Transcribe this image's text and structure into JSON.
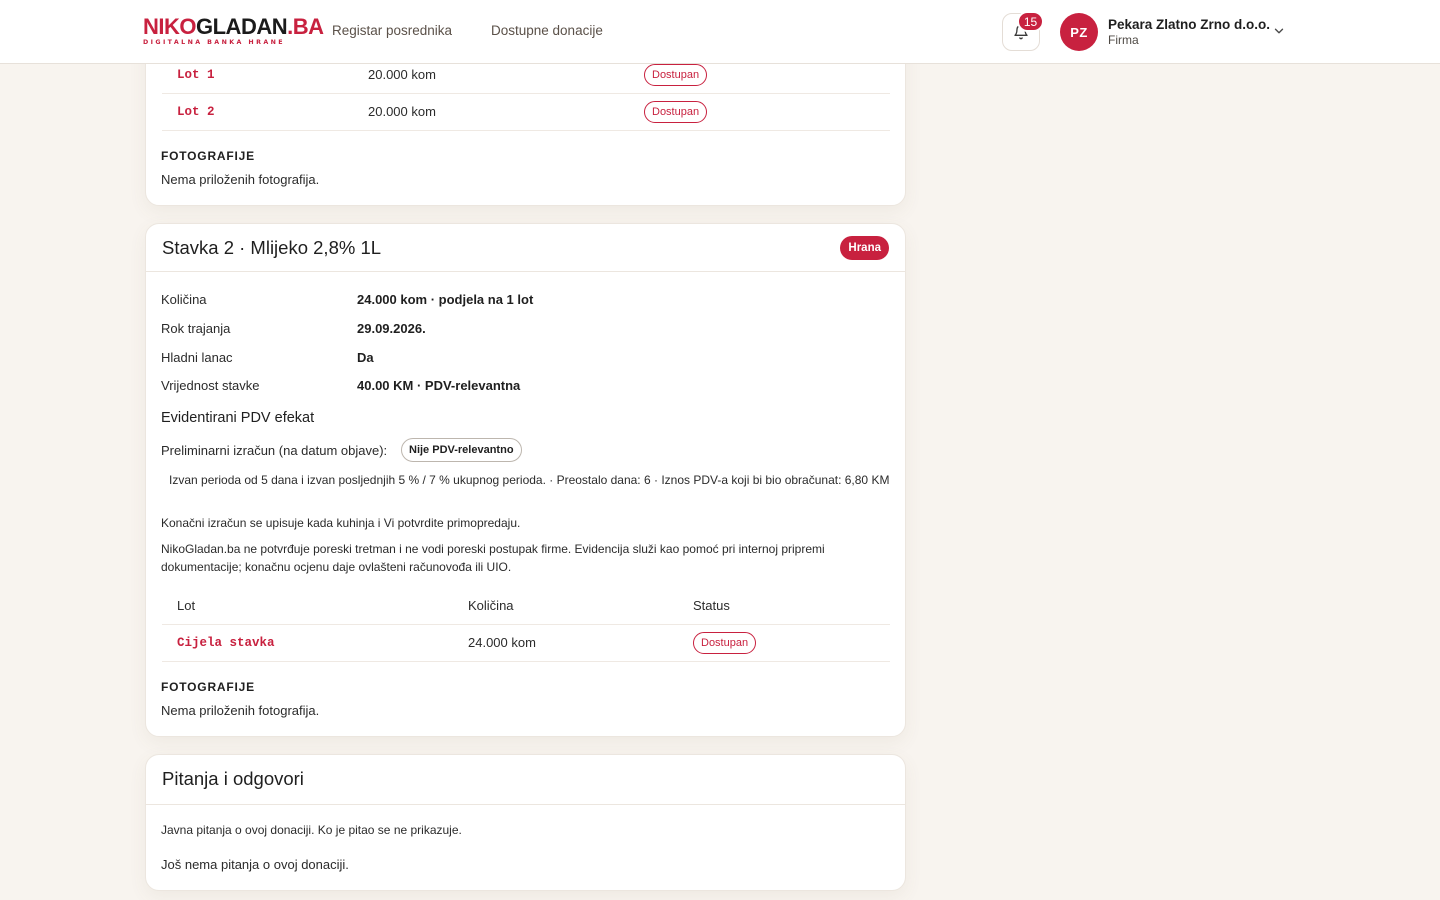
{
  "brand": {
    "logo_part1": "NIKO",
    "logo_part2": "GLADAN",
    "logo_part3": ".BA",
    "tagline": "DIGITALNA BANKA HRANE",
    "accent_color": "#c8213f"
  },
  "nav": {
    "items": [
      {
        "label": "Registar posrednika"
      },
      {
        "label": "Dostupne donacije"
      }
    ]
  },
  "notifications": {
    "count": "15",
    "icon": "bell-icon"
  },
  "user": {
    "initials": "PZ",
    "name": "Pekara Zlatno Zrno d.o.o.",
    "role": "Firma"
  },
  "item1_tail": {
    "lots": [
      {
        "name": "Lot 1",
        "quantity": "20.000 kom",
        "status": "Dostupan"
      },
      {
        "name": "Lot 2",
        "quantity": "20.000 kom",
        "status": "Dostupan"
      }
    ],
    "photos_heading": "FOTOGRAFIJE",
    "photos_text": "Nema priloženih fotografija."
  },
  "item2": {
    "title": "Stavka 2 · Mlijeko 2,8% 1L",
    "category": "Hrana",
    "fields": [
      {
        "label": "Količina",
        "value": "24.000 kom · podjela na 1 lot"
      },
      {
        "label": "Rok trajanja",
        "value": "29.09.2026."
      },
      {
        "label": "Hladni lanac",
        "value": "Da"
      },
      {
        "label": "Vrijednost stavke",
        "value": "40.00 KM · PDV-relevantna"
      }
    ],
    "pdv_heading": "Evidentirani PDV efekat",
    "pdv_preliminary_label": "Preliminarni izračun (na datum objave):",
    "pdv_badge": "Nije PDV-relevantno",
    "pdv_detail": "Izvan perioda od 5 dana i izvan posljednjih 5 % / 7 % ukupnog perioda. · Preostalo dana: 6 · Iznos PDV-a koji bi bio obračunat: 6,80 KM",
    "pdv_final_note": "Konačni izračun se upisuje kada kuhinja i Vi potvrdite primopredaju.",
    "pdv_disclaimer": "NikoGladan.ba ne potvrđuje poreski tretman i ne vodi poreski postupak firme. Evidencija služi kao pomoć pri internoj pripremi dokumentacije; konačnu ocjenu daje ovlašteni računovođa ili UIO.",
    "table_headers": {
      "lot": "Lot",
      "quantity": "Količina",
      "status": "Status"
    },
    "lots": [
      {
        "name": "Cijela stavka",
        "quantity": "24.000 kom",
        "status": "Dostupan"
      }
    ],
    "photos_heading": "FOTOGRAFIJE",
    "photos_text": "Nema priloženih fotografija."
  },
  "qa": {
    "title": "Pitanja i odgovori",
    "description": "Javna pitanja o ovoj donaciji. Ko je pitao se ne prikazuje.",
    "empty_text": "Još nema pitanja o ovoj donaciji."
  }
}
